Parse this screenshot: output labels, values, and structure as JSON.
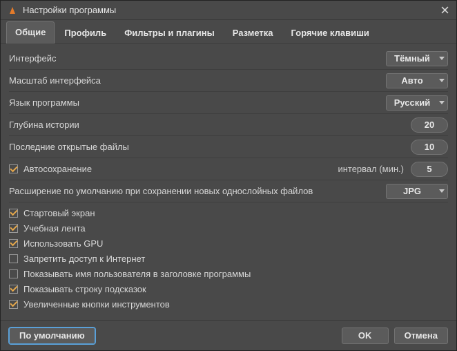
{
  "window": {
    "title": "Настройки программы"
  },
  "tabs": {
    "general": "Общие",
    "profile": "Профиль",
    "filters": "Фильтры и плагины",
    "markup": "Разметка",
    "hotkeys": "Горячие клавиши"
  },
  "settings": {
    "interface_label": "Интерфейс",
    "interface_value": "Тёмный",
    "scale_label": "Масштаб интерфейса",
    "scale_value": "Авто",
    "language_label": "Язык программы",
    "language_value": "Русский",
    "history_label": "Глубина истории",
    "history_value": "20",
    "recent_label": "Последние открытые файлы",
    "recent_value": "10",
    "autosave_label": "Автосохранение",
    "interval_label": "интервал (мин.)",
    "interval_value": "5",
    "default_ext_label": "Расширение по умолчанию при сохранении новых однослойных файлов",
    "default_ext_value": "JPG"
  },
  "checks": {
    "start_screen": "Стартовый экран",
    "learning_feed": "Учебная лента",
    "use_gpu": "Использовать GPU",
    "block_internet": "Запретить доступ к Интернет",
    "show_username": "Показывать имя пользователя в заголовке программы",
    "show_hints": "Показывать строку подсказок",
    "large_tool_buttons": "Увеличенные кнопки инструментов"
  },
  "footer": {
    "defaults": "По умолчанию",
    "ok": "OK",
    "cancel": "Отмена"
  }
}
